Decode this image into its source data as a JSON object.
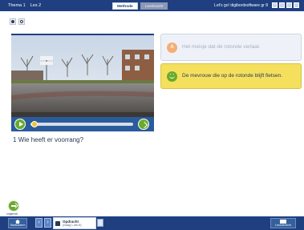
{
  "breadcrumb": {
    "theme": "Thema 1",
    "lesson": "Les 2"
  },
  "tabs": [
    {
      "label": "Methode",
      "active": true
    },
    {
      "label": "Leerkracht",
      "active": false
    }
  ],
  "app_title": "Let's go! digibordsoftware gr 8",
  "window_buttons": [
    "help-icon",
    "menu-icon",
    "minimize-icon",
    "close-icon"
  ],
  "tools": [
    "pen-icon",
    "eraser-icon"
  ],
  "video": {
    "progress": 0.02
  },
  "question": {
    "number": "1",
    "text": "Wie heeft er voorrang?"
  },
  "answers": [
    {
      "badge": "A",
      "text": "Het meisje dat de rotonde verlaat.",
      "state": "dimmed"
    },
    {
      "badge": "smile",
      "text": "De mevrouw die op de rotonde blijft fietsen.",
      "state": "correct"
    }
  ],
  "bottom": {
    "home_label": "Startscherm",
    "next_label": "volgende",
    "assignment_title": "Opdracht",
    "assignment_sub": "(vraag 1 van 8)",
    "right_label": "Lesoverzicht"
  },
  "colors": {
    "bar": "#1f3f80",
    "accent_green": "#6aaa2c",
    "correct_yellow": "#f5e05e"
  }
}
